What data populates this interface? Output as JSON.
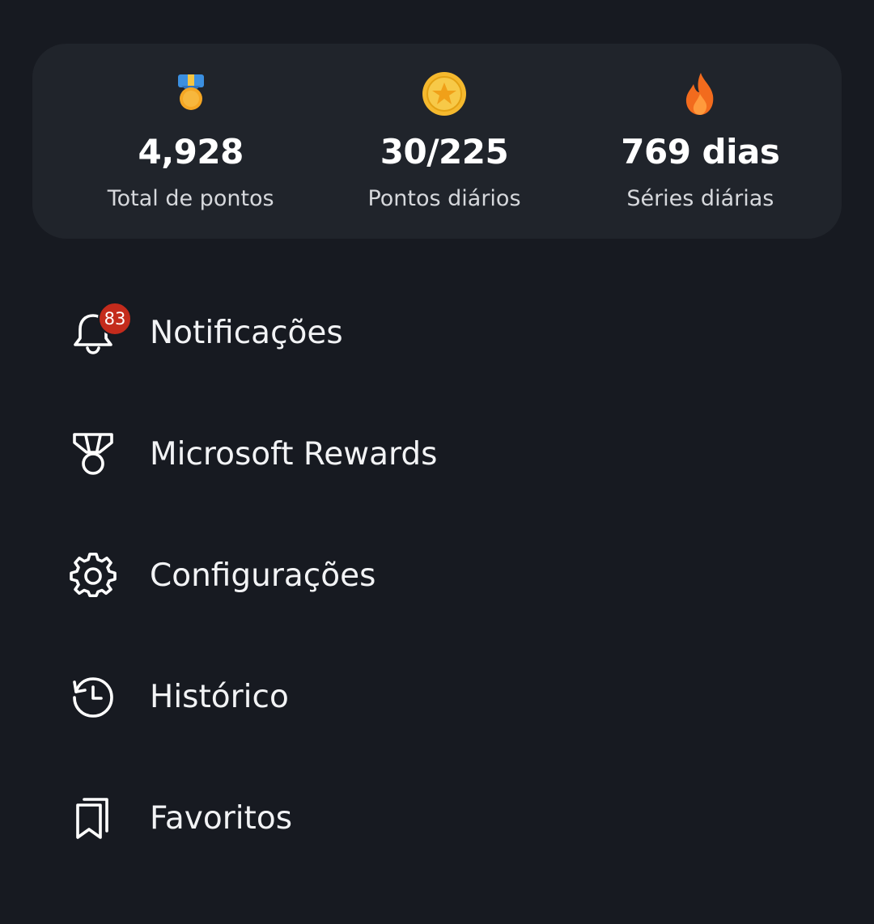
{
  "stats": [
    {
      "icon": "medal-icon",
      "value": "4,928",
      "label": "Total de pontos"
    },
    {
      "icon": "star-coin-icon",
      "value": "30/225",
      "label": "Pontos diários"
    },
    {
      "icon": "flame-icon",
      "value": "769 dias",
      "label": "Séries diárias"
    }
  ],
  "menu": {
    "items": [
      {
        "icon": "bell-icon",
        "label": "Notificações",
        "badge": "83"
      },
      {
        "icon": "rewards-medal-icon",
        "label": "Microsoft Rewards"
      },
      {
        "icon": "gear-icon",
        "label": "Configurações"
      },
      {
        "icon": "history-icon",
        "label": "Histórico"
      },
      {
        "icon": "bookmarks-icon",
        "label": "Favoritos"
      }
    ]
  },
  "colors": {
    "background": "#171a21",
    "card": "#20242b",
    "badge": "#c42b1c",
    "text": "#ffffff",
    "muted": "#d6d8dc"
  }
}
